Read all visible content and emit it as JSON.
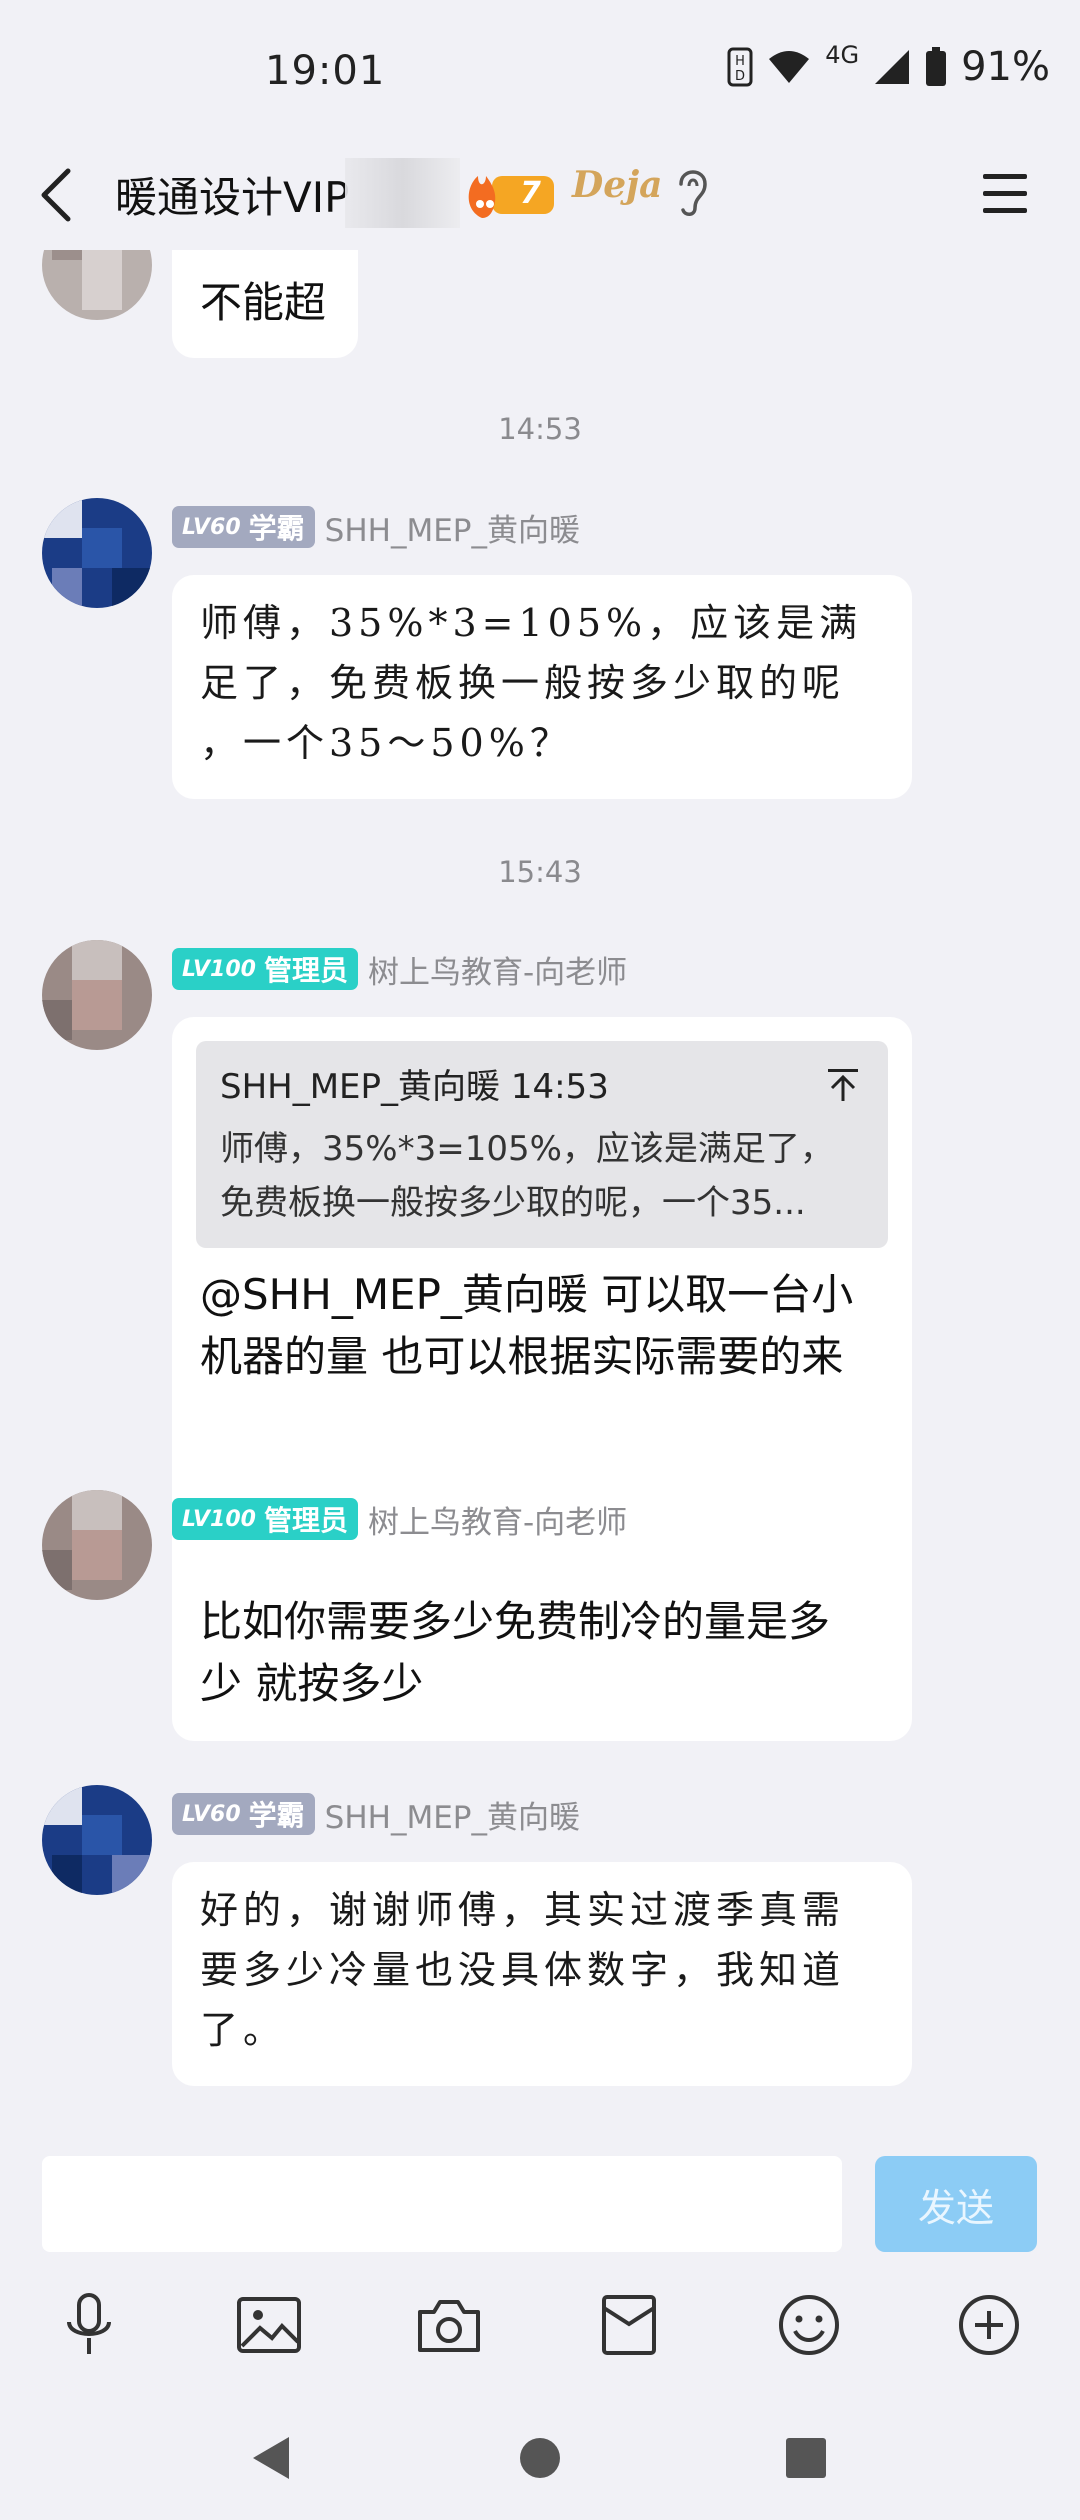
{
  "status_bar": {
    "time": "19:01",
    "network": "4G",
    "battery": "91%"
  },
  "header": {
    "title": "暖通设计VIP",
    "fire_level": "7",
    "badge_text": "Deja"
  },
  "messages": {
    "m0": {
      "text": "不能超"
    },
    "ts1": "14:53",
    "m1": {
      "level": "LV60",
      "role": "学霸",
      "sender": "SHH_MEP_黄向暖",
      "line1": "师傅，35%*3=105%，应该是满",
      "line2": "足了，免费板换一般按多少取的呢",
      "line3": "，一个35～50%？"
    },
    "ts2": "15:43",
    "m2": {
      "level": "LV100",
      "role": "管理员",
      "sender": "树上鸟教育-向老师",
      "quote_header": "SHH_MEP_黄向暖 14:53",
      "quote_line1": "师傅，35%*3=105%，应该是满足了，",
      "quote_line2": "免费板换一般按多少取的呢，一个35...",
      "line1": "@SHH_MEP_黄向暖 可以取一台小",
      "line2": "机器的量 也可以根据实际需要的来"
    },
    "m3": {
      "level": "LV100",
      "role": "管理员",
      "sender": "树上鸟教育-向老师",
      "line1": "比如你需要多少免费制冷的量是多",
      "line2": "少 就按多少"
    },
    "m4": {
      "level": "LV60",
      "role": "学霸",
      "sender": "SHH_MEP_黄向暖",
      "line1": "好的，谢谢师傅，其实过渡季真需",
      "line2": "要多少冷量也没具体数字，我知道",
      "line3": "了。"
    }
  },
  "input": {
    "placeholder": "",
    "send_label": "发送"
  },
  "colors": {
    "background": "#f1f1f6",
    "level_gray": "#a3a9bf",
    "level_teal": "#2ad0c7",
    "send_button": "#8cccf5"
  },
  "toolbar_icons": [
    "microphone-icon",
    "image-icon",
    "camera-icon",
    "red-packet-icon",
    "emoji-icon",
    "plus-icon"
  ],
  "nav_icons": [
    "back-triangle-icon",
    "home-circle-icon",
    "recents-square-icon"
  ]
}
